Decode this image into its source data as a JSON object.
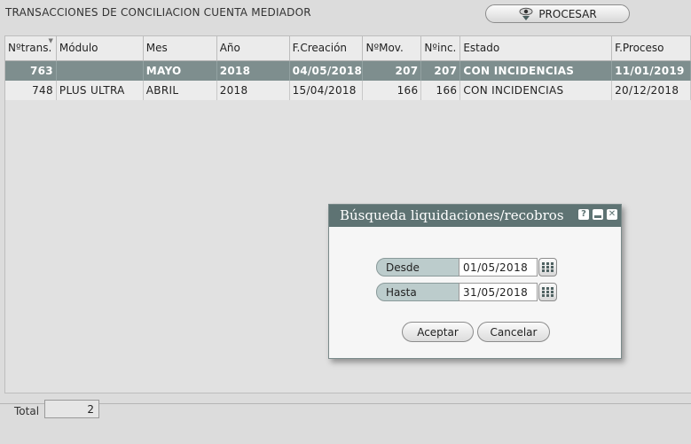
{
  "page": {
    "title": "TRANSACCIONES DE CONCILIACION CUENTA MEDIADOR"
  },
  "toolbar": {
    "procesar_label": "PROCESAR"
  },
  "table": {
    "columns": [
      "Nºtrans.",
      "Módulo",
      "Mes",
      "Año",
      "F.Creación",
      "NºMov.",
      "Nºinc.",
      "Estado",
      "F.Proceso"
    ],
    "rows": [
      [
        "763",
        "",
        "MAYO",
        "2018",
        "04/05/2018",
        "207",
        "207",
        "CON INCIDENCIAS",
        "11/01/2019"
      ],
      [
        "748",
        "PLUS ULTRA",
        "ABRIL",
        "2018",
        "15/04/2018",
        "166",
        "166",
        "CON INCIDENCIAS",
        "20/12/2018"
      ]
    ],
    "selected_row": 0
  },
  "footer": {
    "total_label": "Total",
    "total_value": "2"
  },
  "dialog": {
    "title": "Búsqueda liquidaciones/recobros",
    "desde_label": "Desde",
    "desde_value": "01/05/2018",
    "hasta_label": "Hasta",
    "hasta_value": "31/05/2018",
    "aceptar_label": "Aceptar",
    "cancelar_label": "Cancelar",
    "help_symbol": "?",
    "close_symbol": "✕"
  },
  "colors": {
    "selected_row_bg": "#7e8e8e",
    "dialog_title_bg": "#5e7373",
    "field_label_bg": "#bccccc"
  }
}
